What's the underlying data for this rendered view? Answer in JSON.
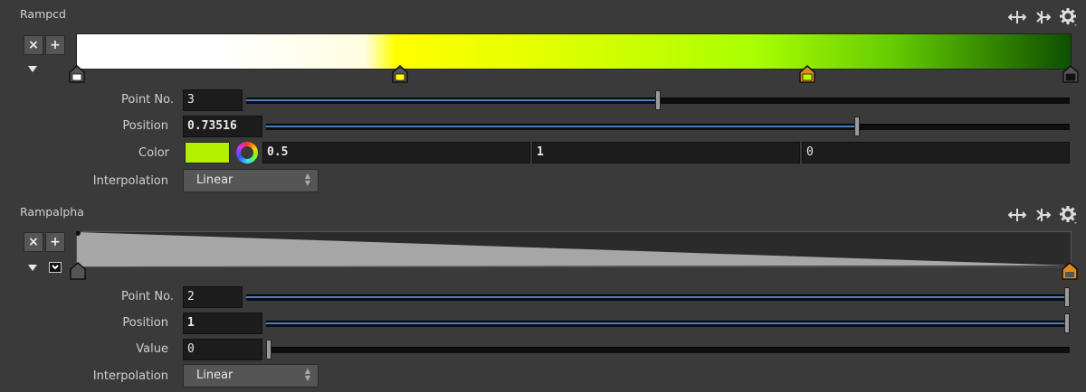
{
  "rampcd": {
    "title": "Rampcd",
    "gradient_stops": [
      "#ffffff",
      "#ffffff",
      "#fffde0",
      "#ffff00",
      "#e8ff00",
      "#aaff00",
      "#66cc00",
      "#0d5000"
    ],
    "key_colors": [
      "#ffffff",
      "#ffff00",
      "#b8ff00",
      "#111111"
    ],
    "point_no_label": "Point No.",
    "point_no": "3",
    "point_no_fraction": 0.5,
    "position_label": "Position",
    "position": "0.73516",
    "position_fraction": 0.73516,
    "color_label": "Color",
    "color_swatch": "#b3f000",
    "color_r": "0.5",
    "color_g": "1",
    "color_b": "0",
    "interp_label": "Interpolation",
    "interpolation": "Linear"
  },
  "rampalpha": {
    "title": "Rampalpha",
    "point_no_label": "Point No.",
    "point_no": "2",
    "point_no_fraction": 1.0,
    "position_label": "Position",
    "position": "1",
    "position_fraction": 1.0,
    "value_label": "Value",
    "value": "0",
    "value_fraction": 0.0,
    "interp_label": "Interpolation",
    "interpolation": "Linear"
  },
  "icons": {
    "delete": "×",
    "add": "+",
    "expand": "▾"
  },
  "colors": {
    "slider_fill": "#4a7fc4",
    "background": "#3a3a3a"
  }
}
